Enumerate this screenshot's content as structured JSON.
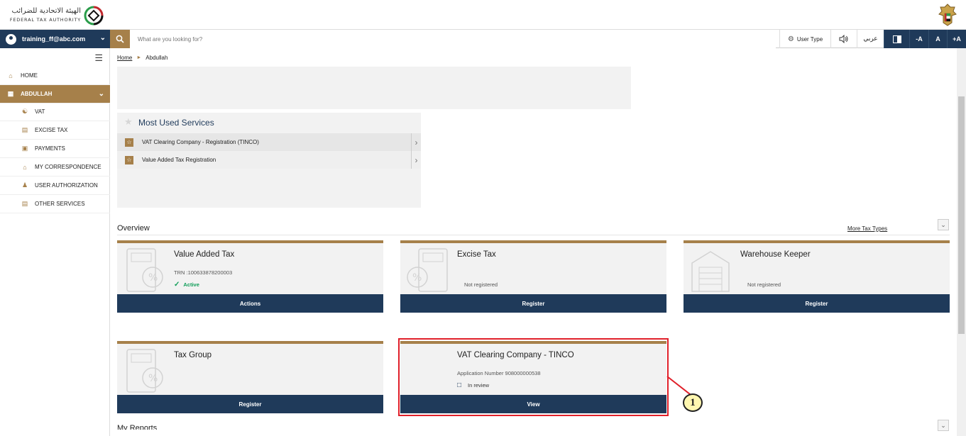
{
  "header": {
    "logo_arabic": "الهيئة الاتحادية للضرائب",
    "logo_english": "FEDERAL TAX AUTHORITY"
  },
  "navbar": {
    "user": "training_ff@abc.com",
    "search_placeholder": "What are you looking for?",
    "user_type": "User Type",
    "language": "عربي",
    "font_decrease": "-A",
    "font_normal": "A",
    "font_increase": "+A"
  },
  "breadcrumb": {
    "home": "Home",
    "current": "Abdullah"
  },
  "sidebar": {
    "items": [
      {
        "label": "HOME",
        "icon": "home-icon"
      },
      {
        "label": "ABDULLAH",
        "icon": "grid-icon"
      },
      {
        "label": "VAT",
        "icon": "vat-icon"
      },
      {
        "label": "EXCISE TAX",
        "icon": "excise-icon"
      },
      {
        "label": "PAYMENTS",
        "icon": "payments-icon"
      },
      {
        "label": "MY CORRESPONDENCE",
        "icon": "correspondence-icon"
      },
      {
        "label": "USER AUTHORIZATION",
        "icon": "user-authorization-icon"
      },
      {
        "label": "OTHER SERVICES",
        "icon": "other-services-icon"
      }
    ]
  },
  "most_used": {
    "title": "Most Used Services",
    "items": [
      "VAT Clearing Company - Registration (TINCO)",
      "Value Added Tax Registration"
    ]
  },
  "overview": {
    "title": "Overview",
    "more_link": "More Tax Types",
    "cards": [
      {
        "title": "Value Added Tax",
        "line1": "TRN :100633878200003",
        "status": "Active",
        "button": "Actions"
      },
      {
        "title": "Excise Tax",
        "status": "Not registered",
        "button": "Register"
      },
      {
        "title": "Warehouse Keeper",
        "status": "Not registered",
        "button": "Register"
      },
      {
        "title": "Tax Group",
        "button": "Register"
      },
      {
        "title": "VAT Clearing Company - TINCO",
        "line1": "Application Number 908000000538",
        "status": "In review",
        "button": "View"
      }
    ]
  },
  "my_reports": "My Reports",
  "callout_number": "1",
  "colors": {
    "navy": "#1f3a5a",
    "gold": "#a6804a",
    "highlight": "#e0202a",
    "active_green": "#0f9d58"
  }
}
